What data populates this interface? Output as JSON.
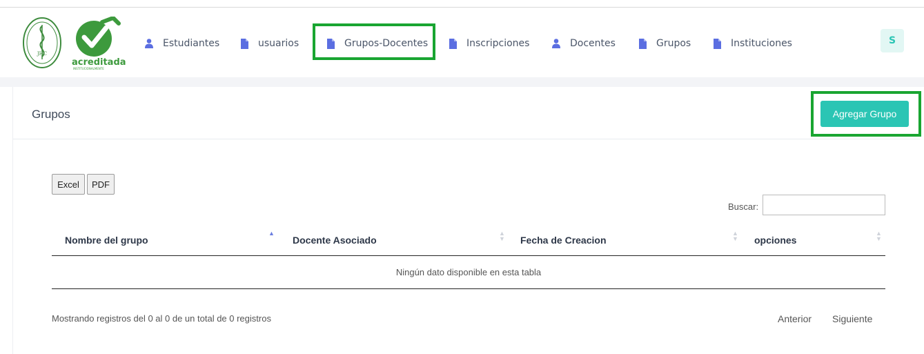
{
  "logo": {
    "seal_text": "JHC",
    "brand_word": "acreditada",
    "brand_sub": "INSTITUCIONALMENTE"
  },
  "nav": {
    "items": [
      {
        "label": "Estudiantes",
        "icon": "user-icon"
      },
      {
        "label": "usuarios",
        "icon": "document-icon"
      },
      {
        "label": "Grupos-Docentes",
        "icon": "document-icon"
      },
      {
        "label": "Inscripciones",
        "icon": "document-icon"
      },
      {
        "label": "Docentes",
        "icon": "user-icon"
      },
      {
        "label": "Grupos",
        "icon": "document-icon"
      },
      {
        "label": "Instituciones",
        "icon": "document-icon"
      }
    ],
    "avatar_initial": "S"
  },
  "card": {
    "title": "Grupos",
    "add_button": "Agregar Grupo"
  },
  "table": {
    "export_buttons": [
      "Excel",
      "PDF"
    ],
    "search_label": "Buscar:",
    "search_value": "",
    "columns": [
      "Nombre del grupo",
      "Docente Asociado",
      "Fecha de Creacion",
      "opciones"
    ],
    "empty_message": "Ningún dato disponible en esta tabla",
    "info": "Mostrando registros del 0 al 0 de un total de 0 registros",
    "pagination": {
      "previous": "Anterior",
      "next": "Siguiente"
    }
  },
  "colors": {
    "accent": "#2bc5b4",
    "highlight_border": "#19a531",
    "nav_icon": "#5b6ee1",
    "brand_green": "#3d9a3d"
  }
}
